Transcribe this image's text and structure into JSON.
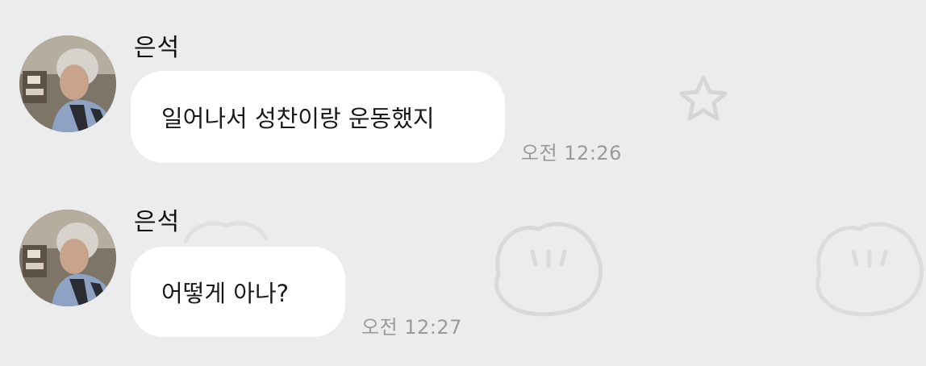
{
  "chat": {
    "messages": [
      {
        "sender": "은석",
        "text": "일어나서 성찬이랑 운동했지",
        "time": "오전 12:26"
      },
      {
        "sender": "은석",
        "text": "어떻게 아나?",
        "time": "오전 12:27"
      }
    ]
  },
  "colors": {
    "background": "#ececec",
    "bubble": "#ffffff",
    "timestamp": "#9a9a9a"
  },
  "icons": {
    "background_pattern": [
      "star-icon",
      "dumpling-icon"
    ]
  }
}
